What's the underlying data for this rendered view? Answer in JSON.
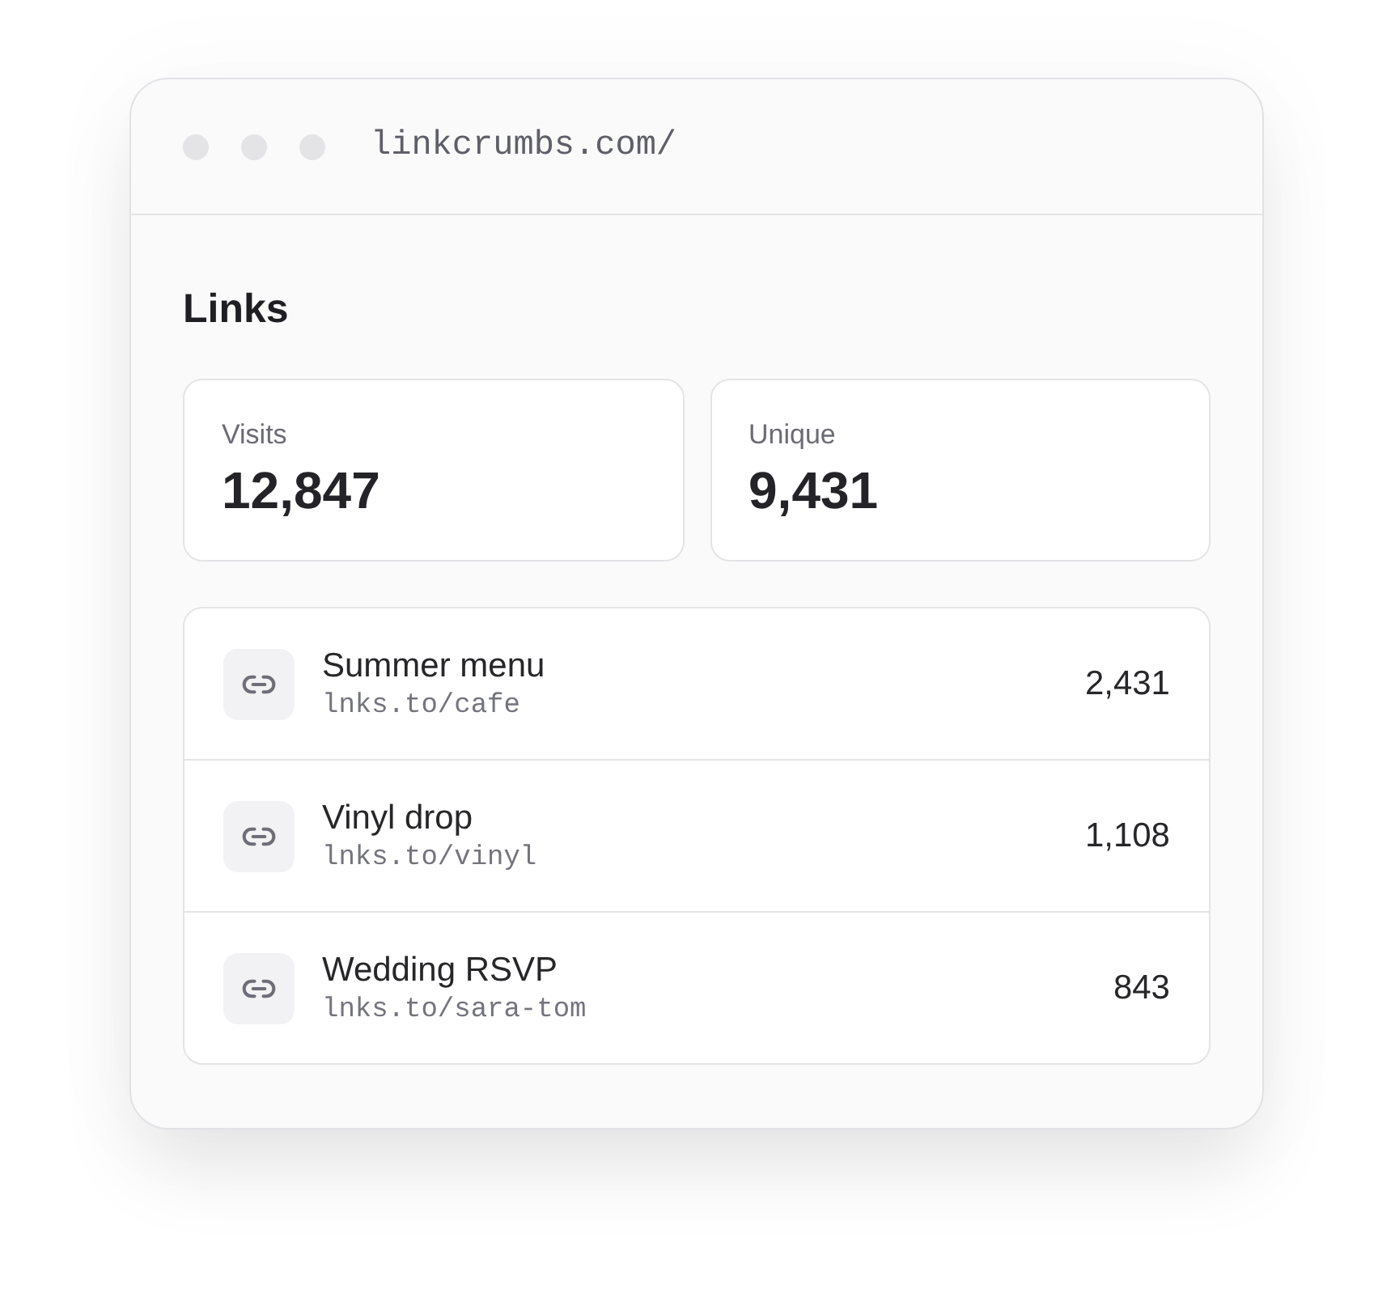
{
  "window": {
    "url": "linkcrumbs.com/"
  },
  "page": {
    "title": "Links"
  },
  "stats": [
    {
      "label": "Visits",
      "value": "12,847"
    },
    {
      "label": "Unique",
      "value": "9,431"
    }
  ],
  "links": [
    {
      "title": "Summer menu",
      "url": "lnks.to/cafe",
      "count": "2,431"
    },
    {
      "title": "Vinyl drop",
      "url": "lnks.to/vinyl",
      "count": "1,108"
    },
    {
      "title": "Wedding RSVP",
      "url": "lnks.to/sara-tom",
      "count": "843"
    }
  ]
}
